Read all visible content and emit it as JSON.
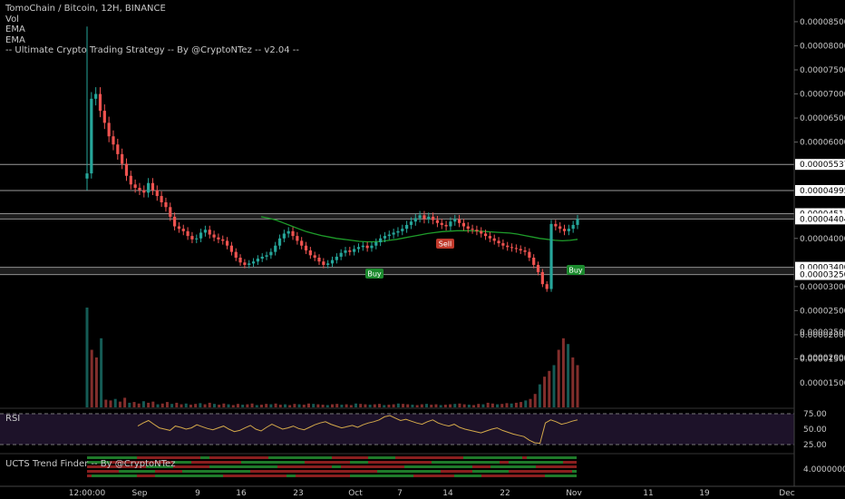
{
  "legend": {
    "title": "TomoChain / Bitcoin, 12H, BINANCE",
    "lines": [
      "Vol",
      "EMA",
      "EMA",
      "-- Ultimate Crypto Trading Strategy -- By @CryptoNTez -- v2.04 --"
    ]
  },
  "panes": {
    "rsi_label": "RSI",
    "trend_label": "UCTS Trend Finder -- By @CryptoNTez"
  },
  "colors": {
    "up": "#26a69a",
    "down": "#ef5350",
    "ema": "#1e9c2a",
    "rsi": "#d4a94a",
    "buy": "#1b8a2d",
    "sell": "#c0392b"
  },
  "chart_data": {
    "type": "candlestick",
    "symbol": "TomoChain / Bitcoin",
    "interval": "12H",
    "exchange": "BINANCE",
    "x_ticks": [
      "12:00:00",
      "Sep",
      "9",
      "16",
      "23",
      "Oct",
      "7",
      "14",
      "22",
      "Nov",
      "11",
      "19",
      "Dec"
    ],
    "price_ticks": [
      "0.00008500",
      "0.00008000",
      "0.00007500",
      "0.00007000",
      "0.00006500",
      "0.00006000",
      "0.00004000",
      "0.00003000",
      "0.00002500",
      "0.00002000",
      "0.00001500"
    ],
    "horizontal_levels": [
      {
        "label": "0.00005537",
        "value": 5.537e-05
      },
      {
        "label": "0.00004995",
        "value": 4.995e-05
      },
      {
        "label": "0.00004514",
        "value": 4.514e-05
      },
      {
        "label": "0.00004404",
        "value": 4.404e-05
      },
      {
        "label": "0.00003400",
        "value": 3.4e-05
      },
      {
        "label": "0.00003250",
        "value": 3.25e-05
      }
    ],
    "price_series": [
      5.35e-05,
      6.9e-05,
      7e-05,
      6.65e-05,
      6.4e-05,
      6.12e-05,
      5.95e-05,
      5.75e-05,
      5.55e-05,
      5.3e-05,
      5.12e-05,
      5.05e-05,
      5e-05,
      4.95e-05,
      5.15e-05,
      5e-05,
      4.88e-05,
      4.75e-05,
      4.65e-05,
      4.45e-05,
      4.25e-05,
      4.2e-05,
      4.15e-05,
      4.05e-05,
      3.98e-05,
      4e-05,
      4.12e-05,
      4.18e-05,
      4.08e-05,
      4.02e-05,
      3.98e-05,
      3.95e-05,
      3.85e-05,
      3.72e-05,
      3.6e-05,
      3.5e-05,
      3.45e-05,
      3.48e-05,
      3.52e-05,
      3.58e-05,
      3.62e-05,
      3.65e-05,
      3.72e-05,
      3.85e-05,
      4e-05,
      4.1e-05,
      4.15e-05,
      4.05e-05,
      3.95e-05,
      3.85e-05,
      3.75e-05,
      3.65e-05,
      3.6e-05,
      3.52e-05,
      3.45e-05,
      3.48e-05,
      3.55e-05,
      3.62e-05,
      3.7e-05,
      3.75e-05,
      3.72e-05,
      3.78e-05,
      3.82e-05,
      3.85e-05,
      3.8e-05,
      3.85e-05,
      3.92e-05,
      4e-05,
      4.05e-05,
      4.08e-05,
      4.12e-05,
      4.15e-05,
      4.2e-05,
      4.28e-05,
      4.35e-05,
      4.42e-05,
      4.48e-05,
      4.4e-05,
      4.45e-05,
      4.38e-05,
      4.32e-05,
      4.28e-05,
      4.25e-05,
      4.35e-05,
      4.4e-05,
      4.32e-05,
      4.25e-05,
      4.2e-05,
      4.18e-05,
      4.15e-05,
      4.1e-05,
      4.05e-05,
      4e-05,
      3.95e-05,
      3.9e-05,
      3.85e-05,
      3.82e-05,
      3.8e-05,
      3.78e-05,
      3.75e-05,
      3.72e-05,
      3.6e-05,
      3.45e-05,
      3.3e-05,
      3.05e-05,
      2.95e-05,
      4.3e-05,
      4.25e-05,
      4.2e-05,
      4.15e-05,
      4.2e-05,
      4.28e-05,
      4.4e-05
    ],
    "ema_series": [
      4.45e-05,
      4.42e-05,
      4.38e-05,
      4.32e-05,
      4.26e-05,
      4.2e-05,
      4.14e-05,
      4.1e-05,
      4.06e-05,
      4.03e-05,
      4e-05,
      3.98e-05,
      3.96e-05,
      3.94e-05,
      3.93e-05,
      3.93e-05,
      3.94e-05,
      3.96e-05,
      3.98e-05,
      4.01e-05,
      4.04e-05,
      4.07e-05,
      4.1e-05,
      4.12e-05,
      4.14e-05,
      4.15e-05,
      4.16e-05,
      4.16e-05,
      4.16e-05,
      4.15e-05,
      4.14e-05,
      4.13e-05,
      4.12e-05,
      4.11e-05,
      4.09e-05,
      4.06e-05,
      4.03e-05,
      4e-05,
      3.98e-05,
      3.96e-05,
      3.95e-05,
      3.96e-05,
      3.98e-05
    ],
    "volume_series": [
      260,
      150,
      130,
      180,
      20,
      18,
      22,
      15,
      25,
      12,
      14,
      10,
      16,
      12,
      15,
      8,
      10,
      14,
      9,
      12,
      8,
      10,
      7,
      9,
      11,
      8,
      12,
      9,
      7,
      10,
      8,
      6,
      9,
      7,
      8,
      10,
      6,
      7,
      9,
      8,
      10,
      7,
      8,
      6,
      9,
      8,
      7,
      10,
      9,
      8,
      7,
      6,
      8,
      9,
      7,
      8,
      6,
      10,
      9,
      8,
      7,
      8,
      9,
      6,
      7,
      8,
      10,
      9,
      8,
      7,
      6,
      8,
      9,
      7,
      8,
      6,
      7,
      8,
      9,
      10,
      8,
      7,
      6,
      9,
      8,
      12,
      10,
      8,
      9,
      11,
      10,
      12,
      14,
      18,
      22,
      35,
      60,
      80,
      95,
      110,
      150,
      180,
      165,
      130,
      110
    ],
    "rsi_series": [
      55,
      60,
      64,
      58,
      52,
      50,
      48,
      55,
      53,
      50,
      52,
      57,
      54,
      51,
      49,
      52,
      55,
      50,
      46,
      48,
      52,
      56,
      50,
      47,
      53,
      58,
      54,
      50,
      52,
      55,
      51,
      49,
      53,
      57,
      60,
      62,
      58,
      55,
      52,
      54,
      56,
      53,
      57,
      60,
      62,
      65,
      70,
      72,
      68,
      64,
      66,
      63,
      60,
      58,
      62,
      65,
      60,
      57,
      55,
      58,
      53,
      50,
      48,
      46,
      44,
      47,
      50,
      52,
      48,
      45,
      42,
      40,
      38,
      32,
      28,
      27,
      60,
      65,
      62,
      58,
      60,
      63,
      65
    ],
    "rsi_levels": [
      "75.00",
      "50.00",
      "25.00"
    ],
    "trend_value_label": "4.00000000",
    "signals": [
      {
        "label": "Buy",
        "type": "buy",
        "at": 0.61
      },
      {
        "label": "Sell",
        "type": "sell",
        "at": 0.78
      },
      {
        "label": "Buy",
        "type": "buy",
        "at": 0.72
      },
      {
        "label": "Buy",
        "type": "buy",
        "at": 0.96
      }
    ]
  }
}
